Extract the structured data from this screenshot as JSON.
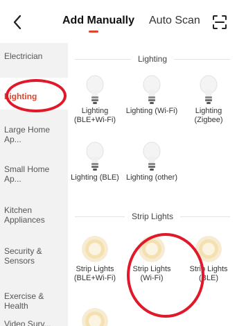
{
  "header": {
    "back_icon": "chevron-left-icon",
    "tabs": [
      {
        "label": "Add Manually",
        "active": true
      },
      {
        "label": "Auto Scan",
        "active": false
      }
    ],
    "scan_icon": "scan-frame-icon",
    "accent_color": "#e0442a"
  },
  "sidebar": {
    "items": [
      {
        "label": "Electrician"
      },
      {
        "label": "Lighting",
        "active": true
      },
      {
        "label": "Large Home Ap..."
      },
      {
        "label": "Small Home Ap..."
      },
      {
        "label": "Kitchen Appliances"
      },
      {
        "label": "Security & Sensors"
      },
      {
        "label": "Exercise & Health"
      },
      {
        "label": "Video Surv..."
      }
    ]
  },
  "main": {
    "sections": [
      {
        "title": "Lighting",
        "devices": [
          {
            "label": "Lighting (BLE+Wi-Fi)",
            "icon": "light-bulb-icon"
          },
          {
            "label": "Lighting (Wi-Fi)",
            "icon": "light-bulb-icon"
          },
          {
            "label": "Lighting (Zigbee)",
            "icon": "light-bulb-icon"
          },
          {
            "label": "Lighting (BLE)",
            "icon": "light-bulb-icon"
          },
          {
            "label": "Lighting (other)",
            "icon": "light-bulb-icon"
          }
        ]
      },
      {
        "title": "Strip Lights",
        "devices": [
          {
            "label": "Strip Lights (BLE+Wi-Fi)",
            "icon": "strip-light-icon"
          },
          {
            "label": "Strip Lights (Wi-Fi)",
            "icon": "strip-light-icon"
          },
          {
            "label": "Strip Lights (BLE)",
            "icon": "strip-light-icon"
          },
          {
            "label": "",
            "icon": "strip-light-icon"
          }
        ]
      }
    ]
  },
  "annotation_color": "#e0182a"
}
